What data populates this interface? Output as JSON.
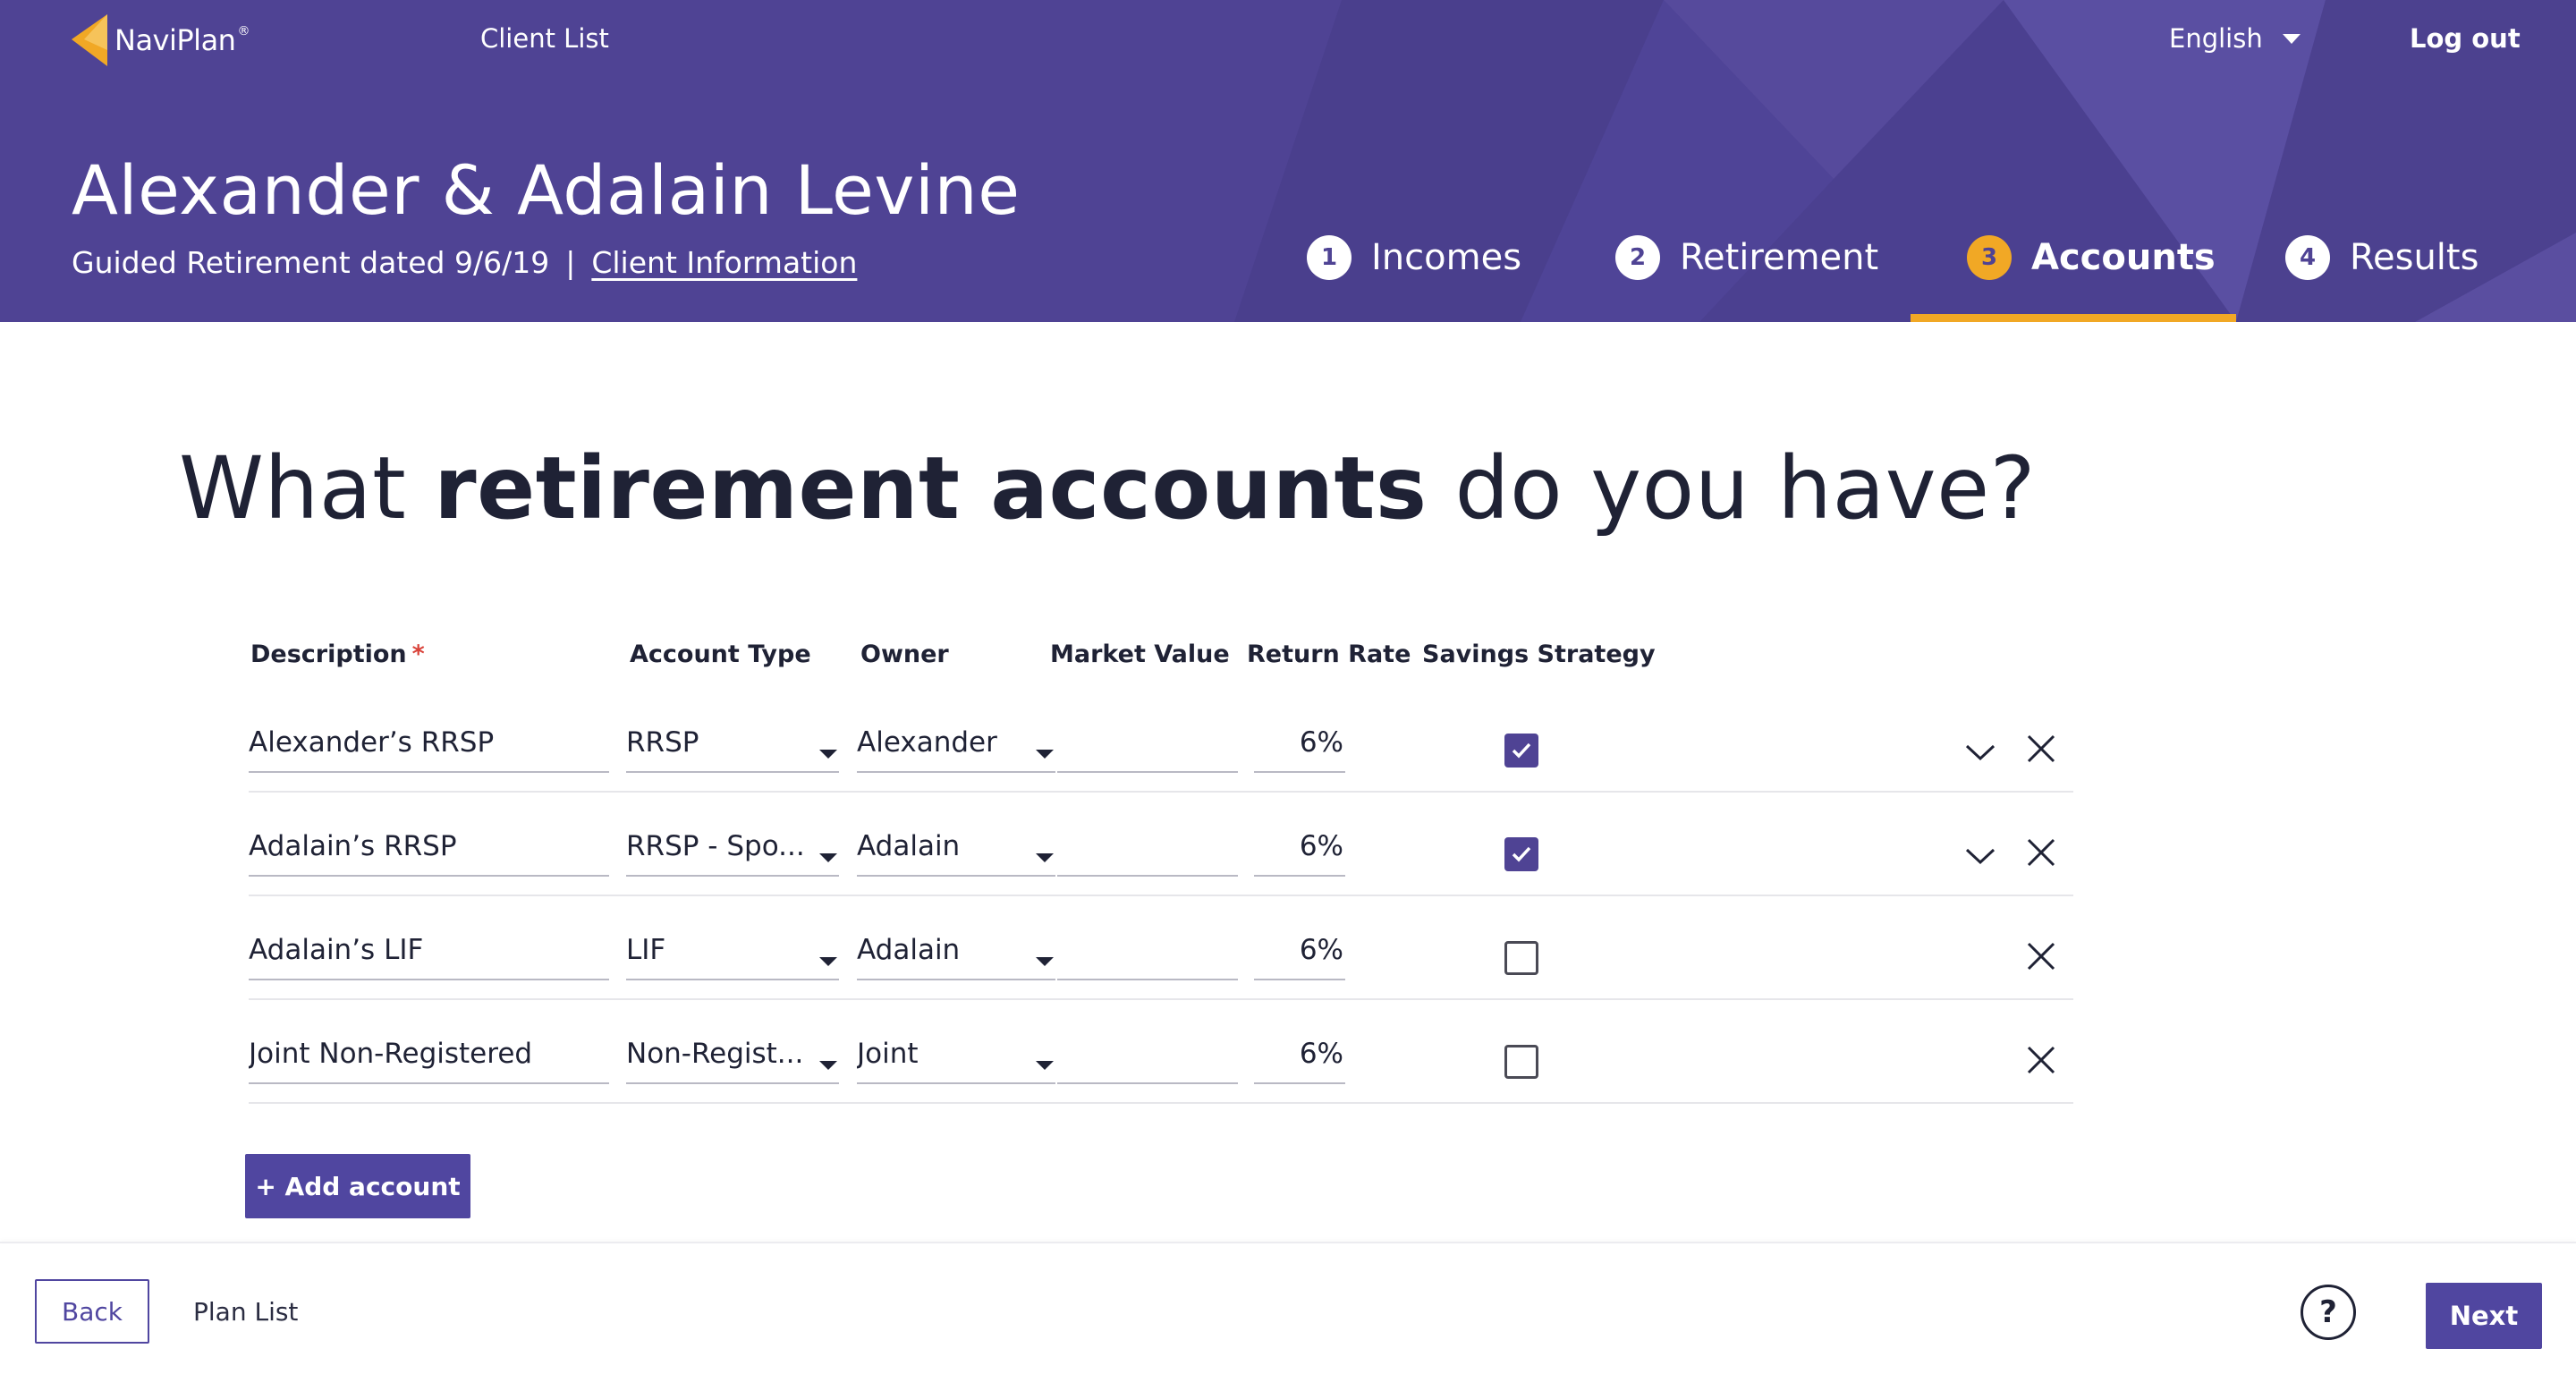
{
  "brand": {
    "name": "NaviPlan",
    "reg": "®",
    "accent": "#f1a825",
    "primary": "#4f4394"
  },
  "nav": {
    "client_list": "Client List",
    "language": "English",
    "logout": "Log out"
  },
  "client": {
    "name": "Alexander & Adalain Levine",
    "plan": "Guided Retirement dated 9/6/19",
    "separator": "|",
    "client_info": "Client Information"
  },
  "steps": [
    {
      "num": "1",
      "label": "Incomes",
      "active": false
    },
    {
      "num": "2",
      "label": "Retirement",
      "active": false
    },
    {
      "num": "3",
      "label": "Accounts",
      "active": true
    },
    {
      "num": "4",
      "label": "Results",
      "active": false
    }
  ],
  "question": {
    "pre": "What ",
    "bold": "retirement accounts",
    "post": " do you have?"
  },
  "table": {
    "headers": {
      "description": "Description",
      "required": "*",
      "account_type": "Account Type",
      "owner": "Owner",
      "market_value": "Market Value",
      "return_rate": "Return Rate",
      "savings_strategy": "Savings Strategy"
    },
    "rows": [
      {
        "description": "Alexander’s RRSP",
        "account_type": "RRSP",
        "owner": "Alexander",
        "market_value": "",
        "return_rate": "6%",
        "savings_strategy": true,
        "expand_icon": "chevron-down-icon",
        "remove_icon": "close-icon"
      },
      {
        "description": "Adalain’s RRSP",
        "account_type": "RRSP - Spo...",
        "owner": "Adalain",
        "market_value": "",
        "return_rate": "6%",
        "savings_strategy": true,
        "expand_icon": "chevron-down-icon",
        "remove_icon": "close-icon"
      },
      {
        "description": "Adalain’s LIF",
        "account_type": "LIF",
        "owner": "Adalain",
        "market_value": "",
        "return_rate": "6%",
        "savings_strategy": false,
        "remove_icon": "close-icon"
      },
      {
        "description": "Joint Non-Registered",
        "account_type": "Non-Regist...",
        "owner": "Joint",
        "market_value": "",
        "return_rate": "6%",
        "savings_strategy": false,
        "remove_icon": "close-icon"
      }
    ]
  },
  "actions": {
    "add_account": "+ Add account"
  },
  "footer": {
    "back": "Back",
    "plan_list": "Plan List",
    "help": "?",
    "next": "Next"
  }
}
